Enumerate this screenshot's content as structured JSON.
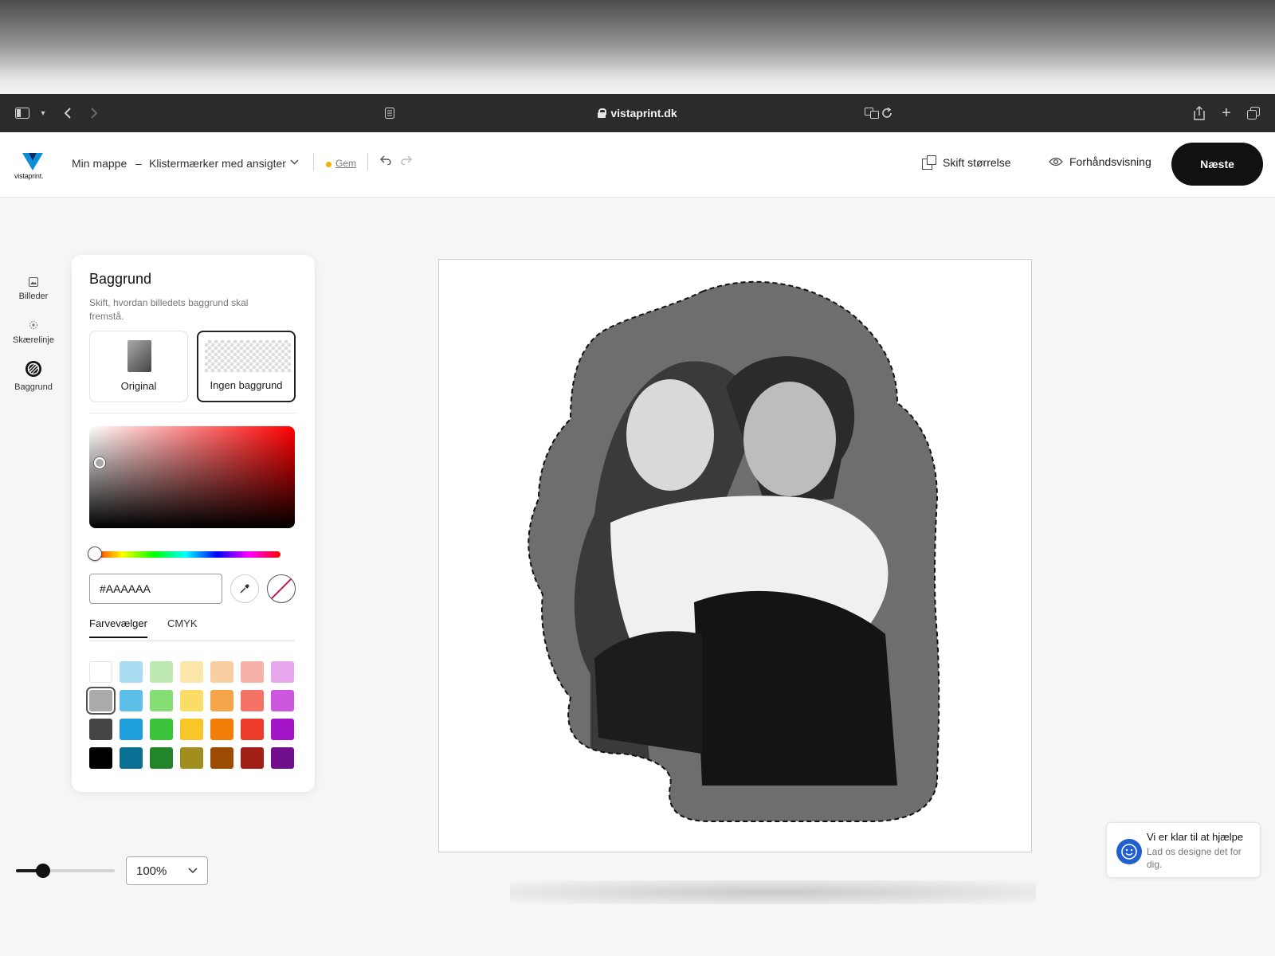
{
  "browser": {
    "url": "vistaprint.dk"
  },
  "header": {
    "logo_text": "vistaprint.",
    "folder": "Min mappe",
    "separator": "–",
    "project_name": "Klistermærker med ansigter",
    "save_label": "Gem",
    "resize_label": "Skift størrelse",
    "preview_label": "Forhåndsvisning",
    "next_label": "Næste"
  },
  "rail": {
    "items": [
      {
        "label": "Billeder",
        "icon": "image-icon"
      },
      {
        "label": "Skærelinje",
        "icon": "cutline-icon"
      },
      {
        "label": "Baggrund",
        "icon": "background-icon"
      }
    ]
  },
  "panel": {
    "title": "Baggrund",
    "subtitle": "Skift, hvordan billedets baggrund skal fremstå.",
    "options": [
      {
        "label": "Original",
        "selected": false
      },
      {
        "label": "Ingen baggrund",
        "selected": true
      }
    ],
    "hex_value": "#AAAAAA",
    "tabs": [
      {
        "label": "Farvevælger",
        "active": true
      },
      {
        "label": "CMYK",
        "active": false
      }
    ],
    "selected_swatch": "#aaaaaa",
    "swatches": [
      [
        "#ffffff",
        "#a9dcf0",
        "#bfe9b3",
        "#fbe7a9",
        "#f8cfa1",
        "#f6b2a8",
        "#e6a7ec"
      ],
      [
        "#aaaaaa",
        "#5cc0e8",
        "#86de74",
        "#fbdc66",
        "#f7a54b",
        "#f47266",
        "#cc57de"
      ],
      [
        "#454545",
        "#1e9fdc",
        "#3bc43b",
        "#f8c629",
        "#f47e0a",
        "#ec3a2b",
        "#a415c8"
      ],
      [
        "#000000",
        "#0c6f94",
        "#23852a",
        "#a08e1d",
        "#9c4b03",
        "#a21f17",
        "#710e8c"
      ]
    ]
  },
  "canvas": {
    "cut_background": "#6e6e6e"
  },
  "zoom": {
    "level": "100%",
    "slider_fraction": 0.27
  },
  "help": {
    "title": "Vi er klar til at hjælpe",
    "text": "Lad os designe det for dig."
  }
}
